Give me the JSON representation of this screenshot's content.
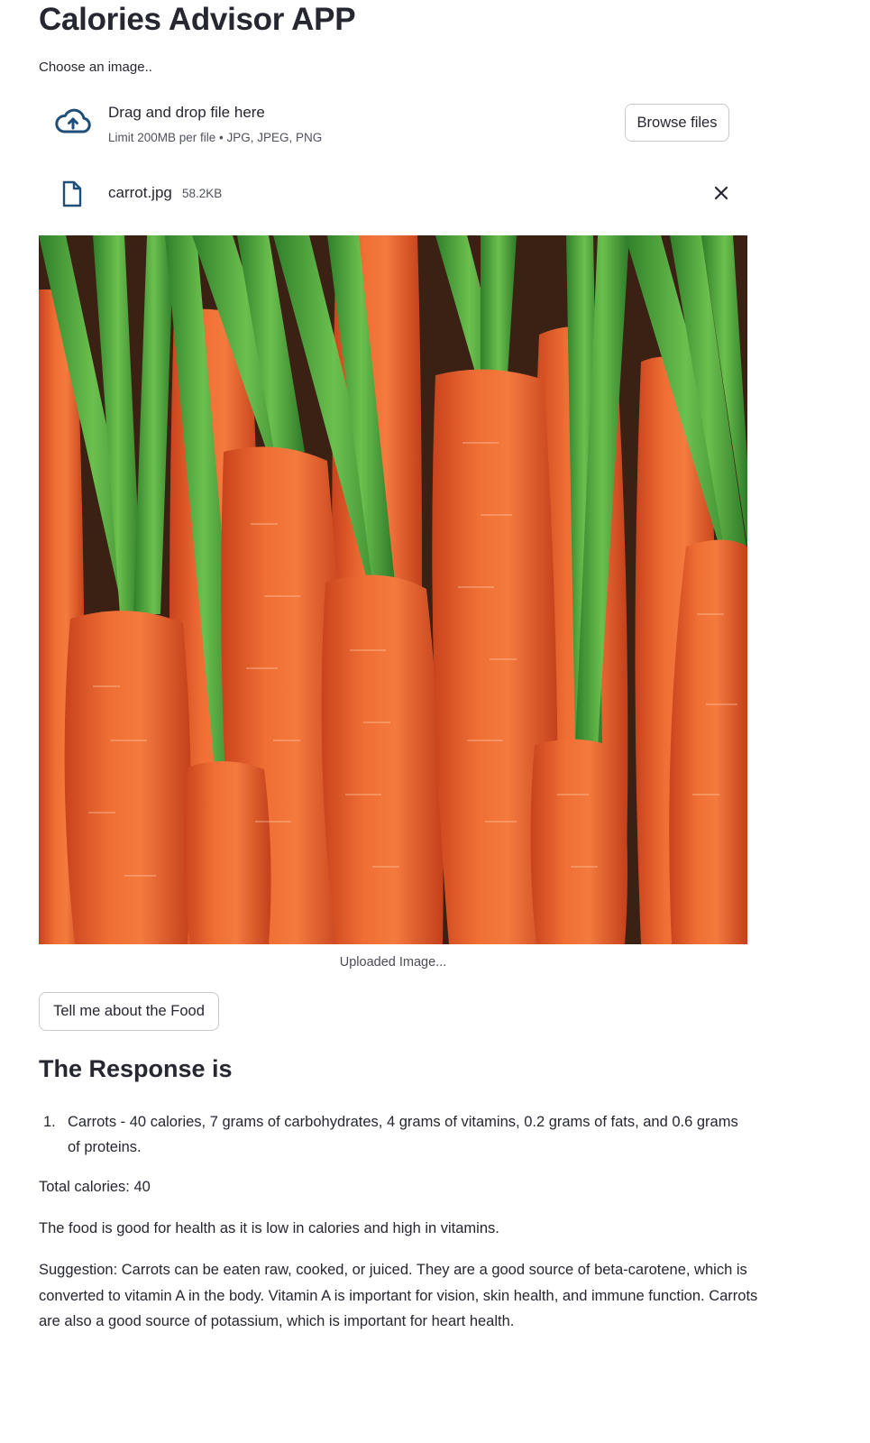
{
  "app": {
    "title": "Calories Advisor APP"
  },
  "uploader": {
    "label": "Choose an image..",
    "dropzone_title": "Drag and drop file here",
    "dropzone_limit": "Limit 200MB per file • JPG, JPEG, PNG",
    "browse_label": "Browse files",
    "file": {
      "name": "carrot.jpg",
      "size": "58.2KB"
    }
  },
  "image": {
    "caption": "Uploaded Image..."
  },
  "actions": {
    "food_button": "Tell me about the Food"
  },
  "response": {
    "heading": "The Response is",
    "items": [
      {
        "number": "1.",
        "text": "Carrots - 40 calories, 7 grams of carbohydrates, 4 grams of vitamins, 0.2 grams of fats, and 0.6 grams of proteins."
      }
    ],
    "total": "Total calories: 40",
    "assessment": "The food is good for health as it is low in calories and high in vitamins.",
    "suggestion": "Suggestion: Carrots can be eaten raw, cooked, or juiced. They are a good source of beta-carotene, which is converted to vitamin A in the body. Vitamin A is important for vision, skin health, and immune function. Carrots are also a good source of potassium, which is important for heart health."
  },
  "icons": {
    "upload": "cloud-upload-icon",
    "file": "file-icon",
    "close": "close-icon"
  },
  "colors": {
    "accent": "#1f4e79",
    "text": "#262730",
    "carrot": "#e8632b",
    "greens": "#4ea83a"
  }
}
